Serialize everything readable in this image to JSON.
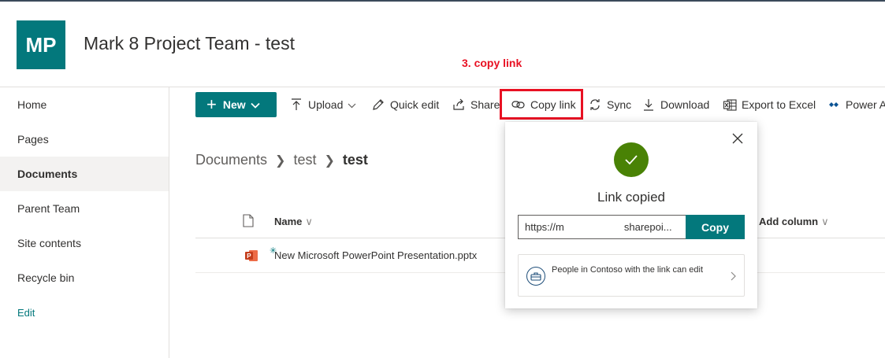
{
  "site": {
    "logo_initials": "MP",
    "title": "Mark 8 Project Team - test",
    "accent_color": "#03787c"
  },
  "annotation": {
    "text": "3. copy link",
    "color": "#e81123"
  },
  "nav": {
    "items": [
      {
        "label": "Home"
      },
      {
        "label": "Pages"
      },
      {
        "label": "Documents",
        "selected": true
      },
      {
        "label": "Parent Team"
      },
      {
        "label": "Site contents"
      },
      {
        "label": "Recycle bin"
      }
    ],
    "edit_label": "Edit"
  },
  "toolbar": {
    "new_label": "New",
    "upload_label": "Upload",
    "quick_edit_label": "Quick edit",
    "share_label": "Share",
    "copy_link_label": "Copy link",
    "sync_label": "Sync",
    "download_label": "Download",
    "export_label": "Export to Excel",
    "power_label": "Power A"
  },
  "breadcrumb": {
    "items": [
      "Documents",
      "test"
    ],
    "current": "test"
  },
  "list": {
    "columns": {
      "name": "Name",
      "add_column": "Add column"
    },
    "rows": [
      {
        "name": "New Microsoft PowerPoint Presentation.pptx",
        "type_icon": "powerpoint-icon"
      }
    ]
  },
  "copy_link_panel": {
    "status": "Link copied",
    "link_prefix": "https://m",
    "link_suffix": "sharepoi...",
    "copy_button": "Copy",
    "permission_text": "People in Contoso with the link can edit",
    "success_color": "#498205"
  }
}
